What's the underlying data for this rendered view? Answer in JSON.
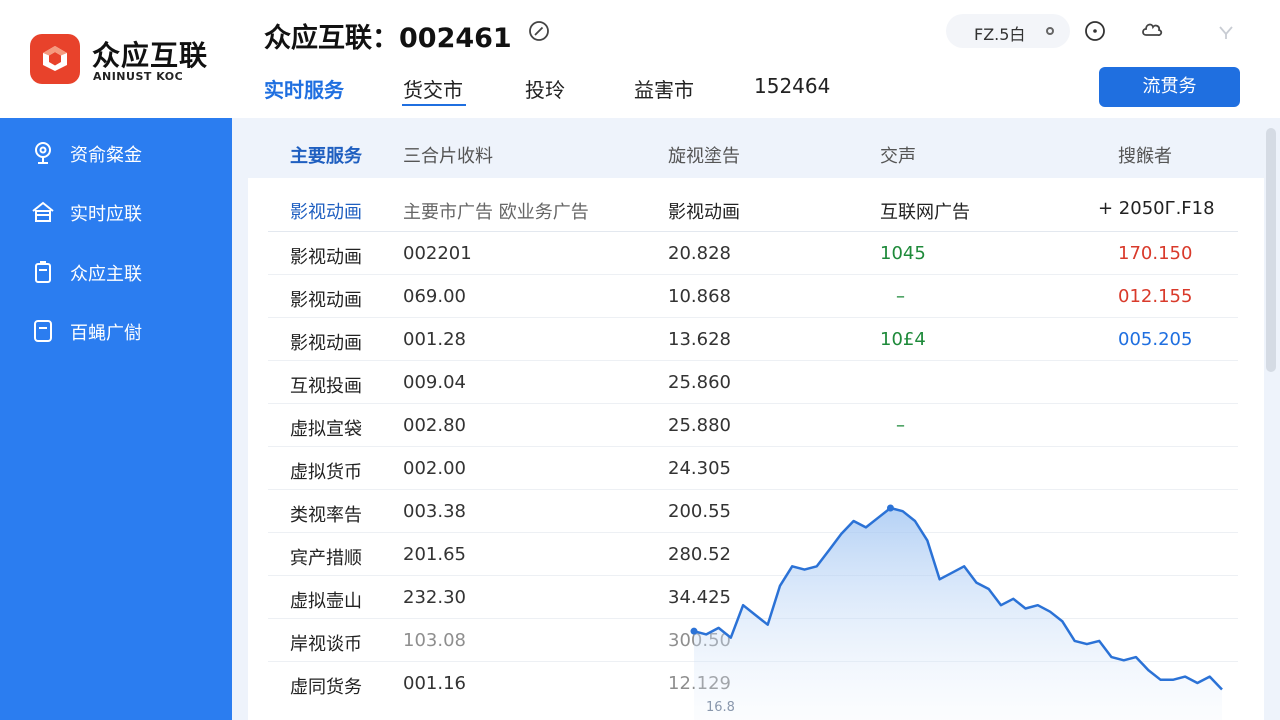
{
  "app": {
    "brand_name": "众应互联",
    "brand_sub": "ANINUST KOC",
    "title": "众应互联：002461"
  },
  "colors": {
    "accent": "#1f6fe0",
    "sidebar": "#2b7df0",
    "logo": "#e8422b",
    "up": "#d93a2b",
    "down": "#1e8a3a"
  },
  "nav": {
    "tabs": [
      {
        "label": "实时服务"
      },
      {
        "label": "货交市"
      },
      {
        "label": "投玲"
      },
      {
        "label": "益害市"
      },
      {
        "label": "152464"
      }
    ],
    "active_index": 1
  },
  "top_right": {
    "status_text": "FZ.5白",
    "action_label": "流贯务",
    "icons": [
      "dot-icon",
      "info-icon",
      "cloud-icon",
      "chevron-down-icon"
    ]
  },
  "sidebar": {
    "items": [
      {
        "label": "资俞粲金",
        "icon": "location-icon"
      },
      {
        "label": "实时应联",
        "icon": "home-icon"
      },
      {
        "label": "众应主联",
        "icon": "clipboard-icon"
      },
      {
        "label": "百蝇广傠",
        "icon": "document-icon"
      }
    ]
  },
  "table": {
    "headers": [
      "主要服务",
      "三合片收料",
      "旋视塗告",
      "交声",
      "搜餱者"
    ],
    "subheader": [
      "影视动画",
      "主要市广告 欧业务广告",
      "影视动画",
      "互联网广告",
      "+ 2050Г.F18"
    ],
    "rows": [
      {
        "name": "影视动画",
        "code": "002201",
        "value": "20.828",
        "change": "1045",
        "extra": "170.150",
        "change_color": "down",
        "extra_color": "up"
      },
      {
        "name": "影视动画",
        "code": "069.00",
        "value": "10.868",
        "change": "–",
        "extra": "012.155",
        "change_color": "down",
        "extra_color": "up"
      },
      {
        "name": "影视动画",
        "code": "001.28",
        "value": "13.628",
        "change": "10£4",
        "extra": "005.205",
        "change_color": "down",
        "extra_color": "accent"
      },
      {
        "name": "互视投画",
        "code": "009.04",
        "value": "25.860",
        "change": "",
        "extra": ""
      },
      {
        "name": "虚拟宣袋",
        "code": "002.80",
        "value": "25.880",
        "change": "–",
        "extra": "",
        "change_color": "down"
      },
      {
        "name": "虚拟货币",
        "code": "002.00",
        "value": "24.305",
        "change": "",
        "extra": ""
      },
      {
        "name": "类视率告",
        "code": "003.38",
        "value": "200.55",
        "change": "",
        "extra": ""
      },
      {
        "name": "宾产措顺",
        "code": "201.65",
        "value": "280.52",
        "change": "",
        "extra": ""
      },
      {
        "name": "虚拟壸山",
        "code": "232.30",
        "value": "34.425",
        "change": "",
        "extra": ""
      },
      {
        "name": "岸视谈币",
        "code": "103.08",
        "value": "300.50",
        "change": "",
        "extra": ""
      },
      {
        "name": "虚同货务",
        "code": "001.16",
        "value": "12.129",
        "change": "",
        "extra": ""
      }
    ]
  },
  "chart_data": {
    "type": "area",
    "x_tick_label": "16.8",
    "values": [
      20,
      19,
      21,
      18,
      28,
      25,
      22,
      34,
      40,
      39,
      40,
      45,
      50,
      54,
      52,
      55,
      58,
      57,
      54,
      48,
      36,
      38,
      40,
      35,
      33,
      28,
      30,
      27,
      28,
      26,
      23,
      17,
      16,
      17,
      12,
      11,
      12,
      8,
      5,
      5,
      6,
      4,
      6,
      2
    ]
  }
}
